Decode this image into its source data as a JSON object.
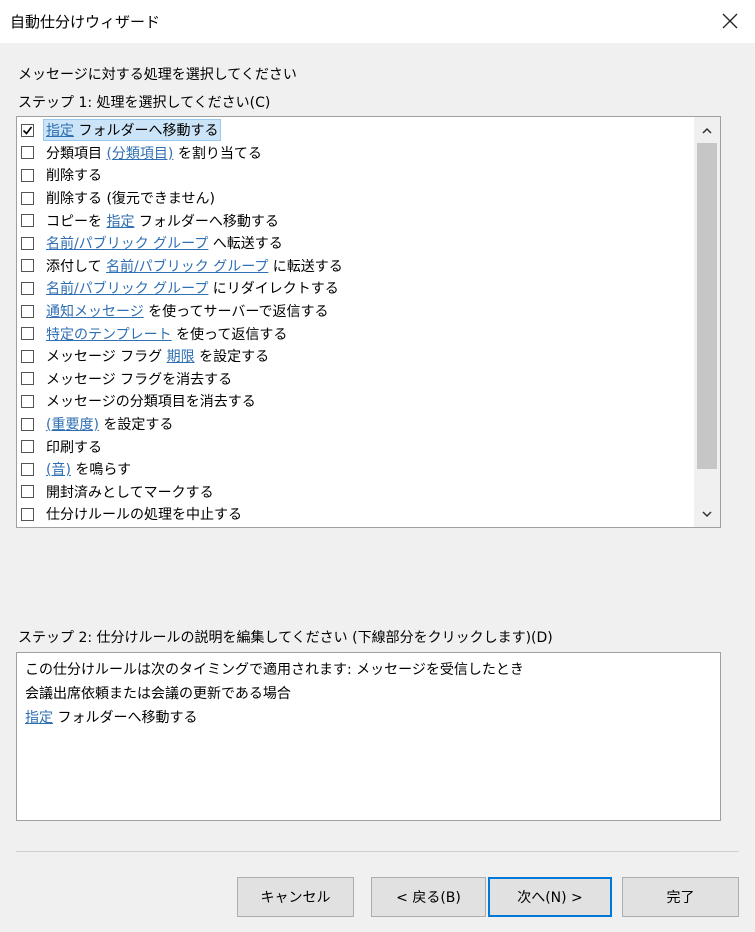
{
  "window": {
    "title": "自動仕分けウィザード"
  },
  "heading": "メッセージに対する処理を選択してください",
  "step1_label": "ステップ 1: 処理を選択してください(C)",
  "actions": [
    {
      "checked": true,
      "selected": true,
      "parts": [
        {
          "text": "指定",
          "link": true
        },
        {
          "text": " フォルダーへ移動する",
          "link": false
        }
      ]
    },
    {
      "checked": false,
      "parts": [
        {
          "text": "分類項目 ",
          "link": false
        },
        {
          "text": "(分類項目)",
          "link": true
        },
        {
          "text": " を割り当てる",
          "link": false
        }
      ]
    },
    {
      "checked": false,
      "parts": [
        {
          "text": "削除する",
          "link": false
        }
      ]
    },
    {
      "checked": false,
      "parts": [
        {
          "text": "削除する (復元できません)",
          "link": false
        }
      ]
    },
    {
      "checked": false,
      "parts": [
        {
          "text": "コピーを ",
          "link": false
        },
        {
          "text": "指定",
          "link": true
        },
        {
          "text": " フォルダーへ移動する",
          "link": false
        }
      ]
    },
    {
      "checked": false,
      "parts": [
        {
          "text": "名前/パブリック グループ",
          "link": true
        },
        {
          "text": " へ転送する",
          "link": false
        }
      ]
    },
    {
      "checked": false,
      "parts": [
        {
          "text": "添付して ",
          "link": false
        },
        {
          "text": "名前/パブリック グループ",
          "link": true
        },
        {
          "text": " に転送する",
          "link": false
        }
      ]
    },
    {
      "checked": false,
      "parts": [
        {
          "text": "名前/パブリック グループ",
          "link": true
        },
        {
          "text": " にリダイレクトする",
          "link": false
        }
      ]
    },
    {
      "checked": false,
      "parts": [
        {
          "text": "通知メッセージ",
          "link": true
        },
        {
          "text": " を使ってサーバーで返信する",
          "link": false
        }
      ]
    },
    {
      "checked": false,
      "parts": [
        {
          "text": "特定のテンプレート",
          "link": true
        },
        {
          "text": " を使って返信する",
          "link": false
        }
      ]
    },
    {
      "checked": false,
      "parts": [
        {
          "text": "メッセージ フラグ ",
          "link": false
        },
        {
          "text": "期限",
          "link": true
        },
        {
          "text": " を設定する",
          "link": false
        }
      ]
    },
    {
      "checked": false,
      "parts": [
        {
          "text": "メッセージ フラグを消去する",
          "link": false
        }
      ]
    },
    {
      "checked": false,
      "parts": [
        {
          "text": "メッセージの分類項目を消去する",
          "link": false
        }
      ]
    },
    {
      "checked": false,
      "parts": [
        {
          "text": "(重要度)",
          "link": true
        },
        {
          "text": " を設定する",
          "link": false
        }
      ]
    },
    {
      "checked": false,
      "parts": [
        {
          "text": "印刷する",
          "link": false
        }
      ]
    },
    {
      "checked": false,
      "parts": [
        {
          "text": "(音)",
          "link": true
        },
        {
          "text": " を鳴らす",
          "link": false
        }
      ]
    },
    {
      "checked": false,
      "parts": [
        {
          "text": "開封済みとしてマークする",
          "link": false
        }
      ]
    },
    {
      "checked": false,
      "parts": [
        {
          "text": "仕分けルールの処理を中止する",
          "link": false
        }
      ]
    }
  ],
  "step2_label": "ステップ 2: 仕分けルールの説明を編集してください (下線部分をクリックします)(D)",
  "description": [
    {
      "parts": [
        {
          "text": "この仕分けルールは次のタイミングで適用されます: メッセージを受信したとき",
          "link": false
        }
      ]
    },
    {
      "parts": [
        {
          "text": "会議出席依頼または会議の更新である場合",
          "link": false
        }
      ]
    },
    {
      "parts": [
        {
          "text": "指定",
          "link": true
        },
        {
          "text": " フォルダーへ移動する",
          "link": false
        }
      ]
    }
  ],
  "buttons": {
    "cancel": "キャンセル",
    "back": "< 戻る(B)",
    "next": "次へ(N) >",
    "finish": "完了"
  },
  "colors": {
    "link": "#2f6fb3",
    "selection": "#cce4f7",
    "default_button_border": "#0078d7"
  }
}
